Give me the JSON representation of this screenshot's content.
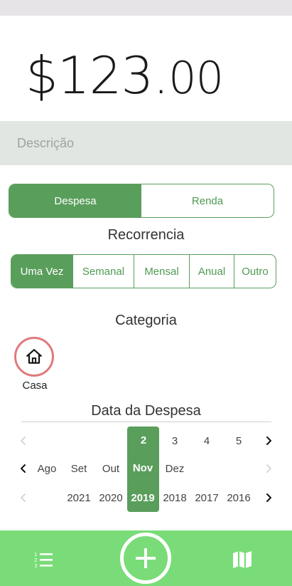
{
  "amount": {
    "main": "$123.",
    "cents": "00"
  },
  "description": {
    "placeholder": "Descrição",
    "value": ""
  },
  "type_toggle": {
    "options": [
      "Despesa",
      "Renda"
    ],
    "selected": "Despesa"
  },
  "recurrence": {
    "title": "Recorrencia",
    "options": [
      "Uma Vez",
      "Semanal",
      "Mensal",
      "Anual",
      "Outro"
    ],
    "selected": "Uma Vez"
  },
  "category": {
    "title": "Categoria",
    "items": [
      {
        "label": "Casa",
        "icon": "house-icon",
        "selected": true
      }
    ]
  },
  "date": {
    "title": "Data da Despesa",
    "days": [
      "2",
      "3",
      "4",
      "5"
    ],
    "selected_day": "2",
    "months": [
      "Ago",
      "Set",
      "Out",
      "Nov",
      "Dez"
    ],
    "selected_month": "Nov",
    "years": [
      "2021",
      "2020",
      "2019",
      "2018",
      "2017",
      "2016"
    ],
    "selected_year": "2019"
  },
  "bottom_nav": {
    "icons": [
      "list-icon",
      "add-icon",
      "map-icon"
    ]
  },
  "colors": {
    "primary_green": "#5a9e5c",
    "bottom_bar": "#79dc78",
    "category_ring": "#e07a7c",
    "description_bg": "#e1e6e3"
  }
}
